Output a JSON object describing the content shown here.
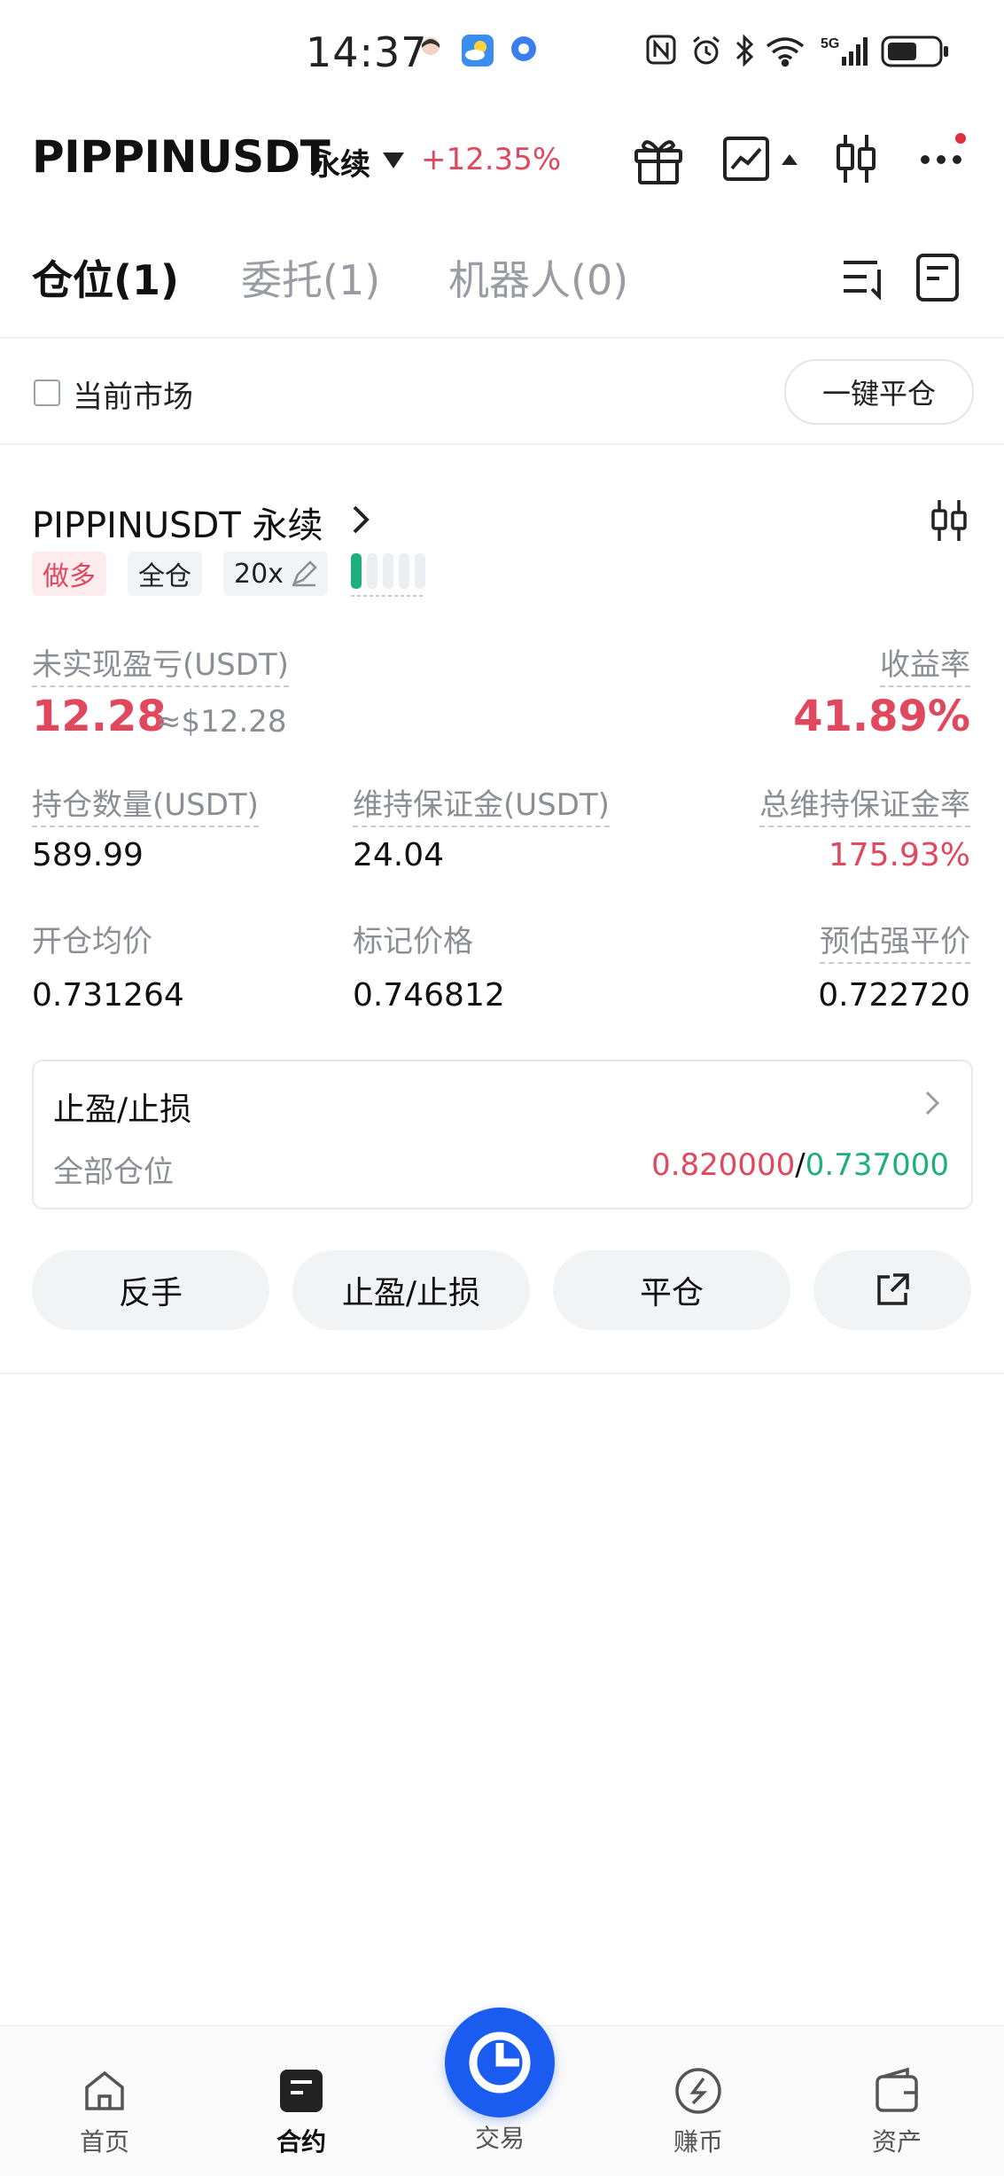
{
  "status_bar": {
    "time": "14:37"
  },
  "header": {
    "symbol": "PIPPINUSDT",
    "contract_type": "永续",
    "change": "+12.35%"
  },
  "tabs": [
    {
      "label": "仓位(1)"
    },
    {
      "label": "委托(1)"
    },
    {
      "label": "机器人(0)"
    }
  ],
  "filter": {
    "current_market": "当前市场",
    "close_all": "一键平仓"
  },
  "position": {
    "title": "PIPPINUSDT 永续",
    "side": "做多",
    "margin_mode": "全仓",
    "leverage": "20x",
    "unrealized_pnl_label": "未实现盈亏(USDT)",
    "unrealized_pnl": "12.28",
    "unrealized_pnl_usd": "≈$12.28",
    "roe_label": "收益率",
    "roe": "41.89%",
    "size_label": "持仓数量(USDT)",
    "size": "589.99",
    "maint_margin_label": "维持保证金(USDT)",
    "maint_margin": "24.04",
    "total_maint_ratio_label": "总维持保证金率",
    "total_maint_ratio": "175.93%",
    "entry_price_label": "开仓均价",
    "entry_price": "0.731264",
    "mark_price_label": "标记价格",
    "mark_price": "0.746812",
    "liq_price_label": "预估强平价",
    "liq_price": "0.722720"
  },
  "tpsl": {
    "title": "止盈/止损",
    "scope": "全部仓位",
    "take_profit": "0.820000",
    "separator": "/",
    "stop_loss": "0.737000"
  },
  "actions": {
    "reverse": "反手",
    "tpsl": "止盈/止损",
    "close": "平仓"
  },
  "bottom_nav": [
    {
      "label": "首页",
      "icon": "home-icon"
    },
    {
      "label": "合约",
      "icon": "futures-icon"
    },
    {
      "label": "交易",
      "icon": "trade-icon"
    },
    {
      "label": "赚币",
      "icon": "earn-icon"
    },
    {
      "label": "资产",
      "icon": "wallet-icon"
    }
  ],
  "colors": {
    "red": "#e0485e",
    "green": "#1fae7d",
    "brand": "#1a5cf0"
  }
}
